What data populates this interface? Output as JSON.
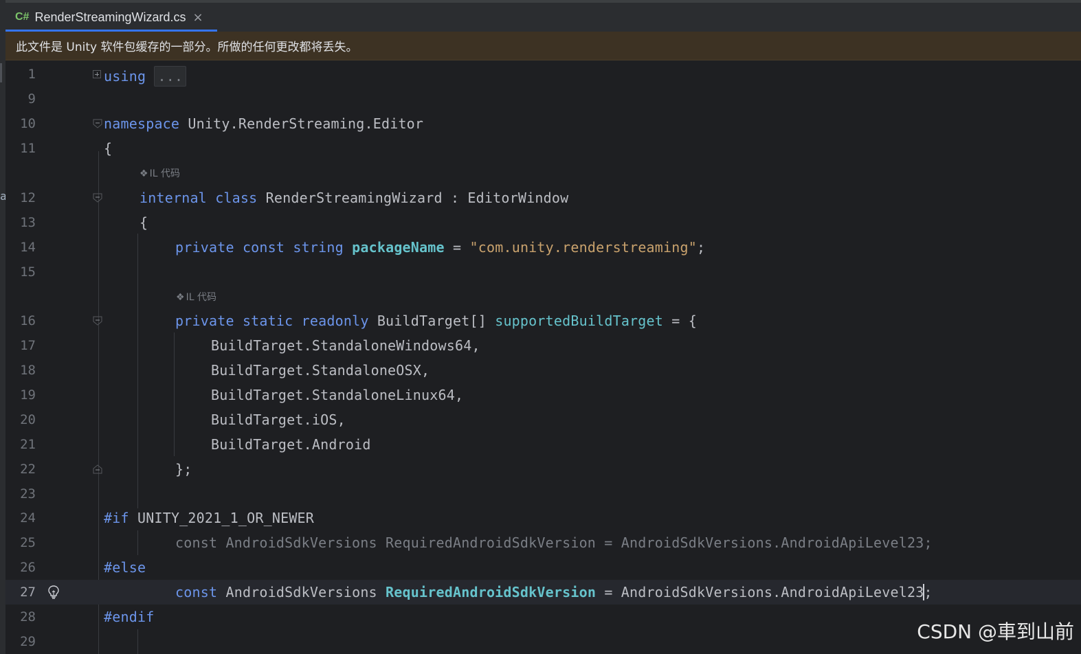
{
  "tab": {
    "icon": "C#",
    "title": "RenderStreamingWizard.cs",
    "close": "×"
  },
  "banner": {
    "text": "此文件是 Unity 软件包缓存的一部分。所做的任何更改都将丢失。"
  },
  "hints": {
    "il_code": "IL 代码"
  },
  "left_strip_char": "a",
  "lines": {
    "l1": {
      "num": "1",
      "kw": "using",
      "collapsed": "..."
    },
    "l9": {
      "num": "9"
    },
    "l10": {
      "num": "10",
      "kw": "namespace",
      "rest": " Unity.RenderStreaming.Editor"
    },
    "l11": {
      "num": "11",
      "text": "{"
    },
    "l12": {
      "num": "12",
      "kw1": "internal",
      "kw2": "class",
      "rest": " RenderStreamingWizard : EditorWindow"
    },
    "l13": {
      "num": "13",
      "text": "{"
    },
    "l14": {
      "num": "14",
      "kw1": "private",
      "kw2": "const",
      "kw3": "string",
      "field": "packageName",
      "mid": " = ",
      "str": "\"com.unity.renderstreaming\"",
      "end": ";"
    },
    "l15": {
      "num": "15"
    },
    "l16": {
      "num": "16",
      "kw1": "private",
      "kw2": "static",
      "kw3": "readonly",
      "type": " BuildTarget[] ",
      "field": "supportedBuildTarget",
      "end": " = {"
    },
    "l17": {
      "num": "17",
      "text": "BuildTarget.StandaloneWindows64,"
    },
    "l18": {
      "num": "18",
      "text": "BuildTarget.StandaloneOSX,"
    },
    "l19": {
      "num": "19",
      "text": "BuildTarget.StandaloneLinux64,"
    },
    "l20": {
      "num": "20",
      "text": "BuildTarget.iOS,"
    },
    "l21": {
      "num": "21",
      "text": "BuildTarget.Android"
    },
    "l22": {
      "num": "22",
      "text": "};"
    },
    "l23": {
      "num": "23"
    },
    "l24": {
      "num": "24",
      "pp": "#if",
      "rest": " UNITY_2021_1_OR_NEWER"
    },
    "l25": {
      "num": "25",
      "text": "const AndroidSdkVersions RequiredAndroidSdkVersion = AndroidSdkVersions.AndroidApiLevel23;"
    },
    "l26": {
      "num": "26",
      "pp": "#else"
    },
    "l27": {
      "num": "27",
      "kw": "const",
      "type": " AndroidSdkVersions ",
      "field": "RequiredAndroidSdkVersion",
      "mid": " = AndroidSdkVersions.AndroidApiLevel23",
      "end": ";"
    },
    "l28": {
      "num": "28",
      "pp": "#endif"
    },
    "l29": {
      "num": "29"
    }
  },
  "watermark": "CSDN @車到山前",
  "colors": {
    "keyword": "#6c95eb",
    "field": "#66c3cc",
    "string": "#c9a26d",
    "text": "#bcbec4",
    "inactive": "#7a7e85",
    "tab_accent": "#3574f0",
    "banner_bg": "#3d3223"
  }
}
